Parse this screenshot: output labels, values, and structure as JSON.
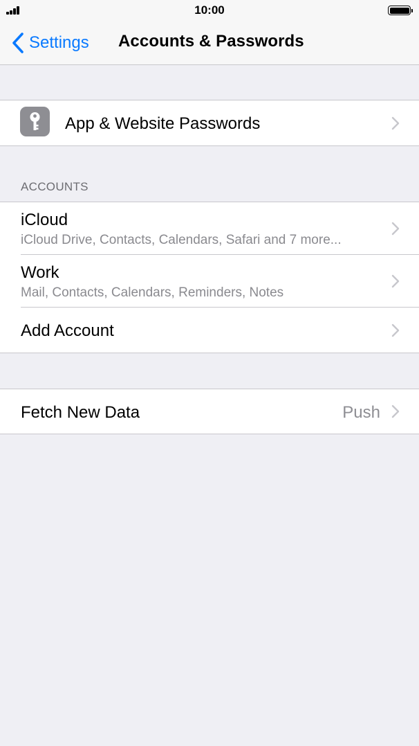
{
  "status_bar": {
    "time": "10:00",
    "signal-icon": "signal-bars-icon",
    "battery-icon": "battery-icon"
  },
  "nav": {
    "back_label": "Settings",
    "back_icon": "chevron-left-icon",
    "title": "Accounts & Passwords"
  },
  "passwords_group": {
    "items": [
      {
        "label": "App & Website Passwords",
        "icon": "key-icon"
      }
    ]
  },
  "accounts_section": {
    "header": "ACCOUNTS",
    "items": [
      {
        "title": "iCloud",
        "subtitle": "iCloud Drive, Contacts, Calendars, Safari and 7 more..."
      },
      {
        "title": "Work",
        "subtitle": "Mail, Contacts, Calendars, Reminders, Notes"
      },
      {
        "title": "Add Account"
      }
    ]
  },
  "fetch_group": {
    "items": [
      {
        "title": "Fetch New Data",
        "value": "Push"
      }
    ]
  },
  "colors": {
    "accent": "#0a7aff",
    "background": "#efeff4",
    "secondary_text": "#8a8a8f"
  }
}
